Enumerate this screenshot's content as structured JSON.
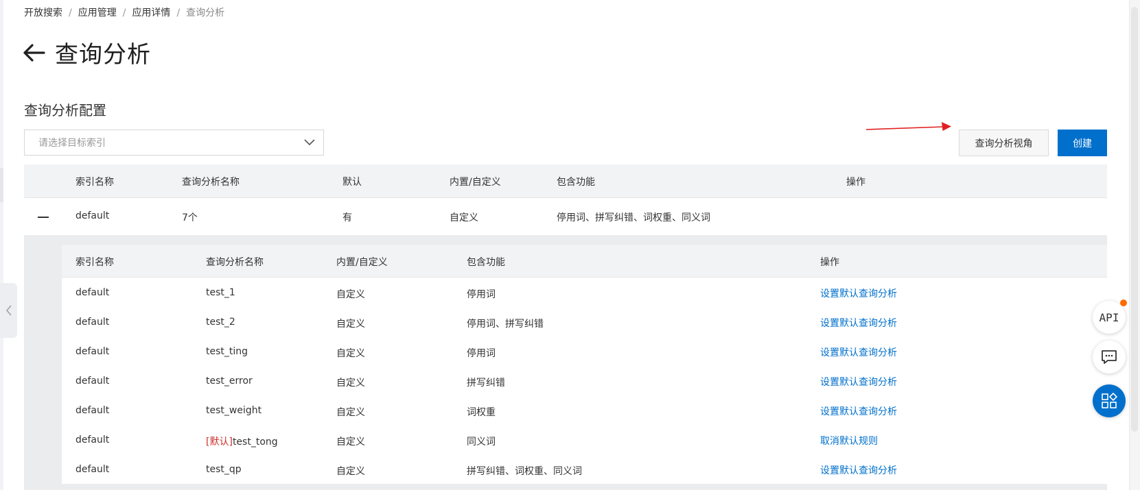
{
  "breadcrumb": {
    "items": [
      "开放搜索",
      "应用管理",
      "应用详情"
    ],
    "current": "查询分析",
    "separator": "/"
  },
  "page": {
    "title": "查询分析",
    "section_title": "查询分析配置"
  },
  "filter": {
    "placeholder": "请选择目标索引"
  },
  "actions": {
    "view_label": "查询分析视角",
    "create_label": "创建"
  },
  "outer_table": {
    "headers": [
      "索引名称",
      "查询分析名称",
      "默认",
      "内置/自定义",
      "包含功能",
      "操作"
    ],
    "row": {
      "index": "default",
      "name": "7个",
      "default": "有",
      "type": "自定义",
      "features": "停用词、拼写纠错、词权重、同义词"
    }
  },
  "inner_table": {
    "headers": [
      "索引名称",
      "查询分析名称",
      "内置/自定义",
      "包含功能",
      "操作"
    ],
    "default_tag": "[默认]",
    "rows": [
      {
        "index": "default",
        "name": "test_1",
        "type": "自定义",
        "features": "停用词",
        "action": "设置默认查询分析"
      },
      {
        "index": "default",
        "name": "test_2",
        "type": "自定义",
        "features": "停用词、拼写纠错",
        "action": "设置默认查询分析"
      },
      {
        "index": "default",
        "name": "test_ting",
        "type": "自定义",
        "features": "停用词",
        "action": "设置默认查询分析"
      },
      {
        "index": "default",
        "name": "test_error",
        "type": "自定义",
        "features": "拼写纠错",
        "action": "设置默认查询分析"
      },
      {
        "index": "default",
        "name": "test_weight",
        "type": "自定义",
        "features": "词权重",
        "action": "设置默认查询分析"
      },
      {
        "index": "default",
        "name": "test_tong",
        "type": "自定义",
        "features": "同义词",
        "action": "取消默认规则"
      },
      {
        "index": "default",
        "name": "test_qp",
        "type": "自定义",
        "features": "拼写纠错、词权重、同义词",
        "action": "设置默认查询分析"
      }
    ]
  },
  "floating": {
    "api_label": "API"
  },
  "colors": {
    "primary": "#0070cc",
    "annotation_arrow": "#e02020",
    "default_tag": "#c9302c"
  }
}
